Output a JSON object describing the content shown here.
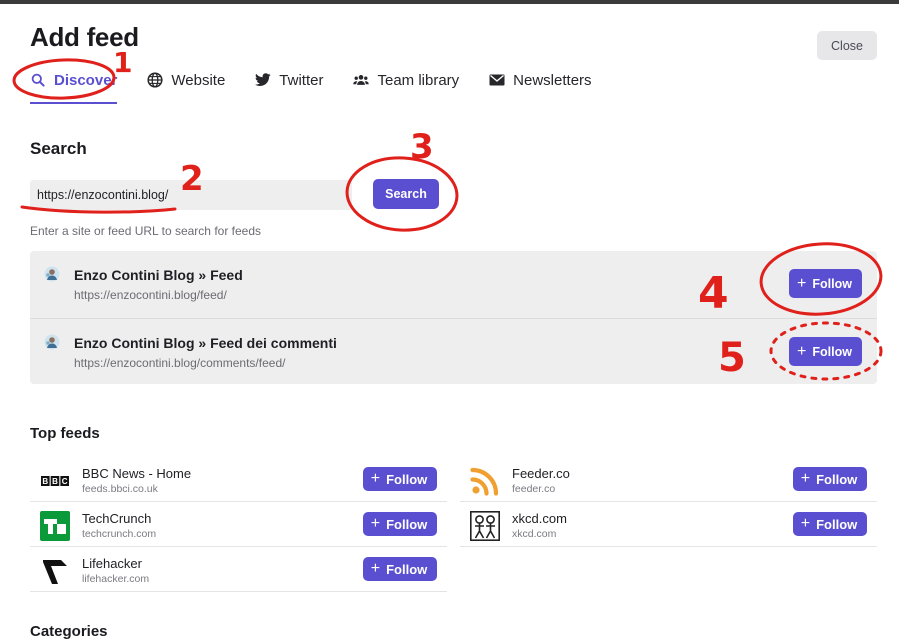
{
  "dialog": {
    "title": "Add feed",
    "close_label": "Close"
  },
  "tabs": [
    {
      "label": "Discover",
      "icon": "search-icon",
      "active": true
    },
    {
      "label": "Website",
      "icon": "globe-icon",
      "active": false
    },
    {
      "label": "Twitter",
      "icon": "twitter-icon",
      "active": false
    },
    {
      "label": "Team library",
      "icon": "team-icon",
      "active": false
    },
    {
      "label": "Newsletters",
      "icon": "envelope-icon",
      "active": false
    }
  ],
  "search": {
    "heading": "Search",
    "value": "https://enzocontini.blog/",
    "button_label": "Search",
    "hint": "Enter a site or feed URL to search for feeds"
  },
  "results": [
    {
      "name": "Enzo Contini Blog » Feed",
      "url": "https://enzocontini.blog/feed/",
      "button_label": "Follow"
    },
    {
      "name": "Enzo Contini Blog » Feed dei commenti",
      "url": "https://enzocontini.blog/comments/feed/",
      "button_label": "Follow"
    }
  ],
  "top_feeds": {
    "heading": "Top feeds",
    "items": [
      {
        "name": "BBC News - Home",
        "url": "feeds.bbci.co.uk",
        "logo": "BBC",
        "button_label": "Follow"
      },
      {
        "name": "Feeder.co",
        "url": "feeder.co",
        "logo": "rss-icon",
        "button_label": "Follow"
      },
      {
        "name": "TechCrunch",
        "url": "techcrunch.com",
        "logo": "TC",
        "button_label": "Follow"
      },
      {
        "name": "xkcd.com",
        "url": "xkcd.com",
        "logo": "xkcd-icon",
        "button_label": "Follow"
      },
      {
        "name": "Lifehacker",
        "url": "lifehacker.com",
        "logo": "lifehacker-icon",
        "button_label": "Follow"
      }
    ]
  },
  "categories": {
    "heading": "Categories"
  },
  "annotations": [
    "1",
    "2",
    "3",
    "4",
    "5"
  ],
  "colors": {
    "accent": "#5a4fd0",
    "annotation": "#e0201b",
    "techcrunch": "#0a9a3a",
    "rss": "#f0a030"
  }
}
